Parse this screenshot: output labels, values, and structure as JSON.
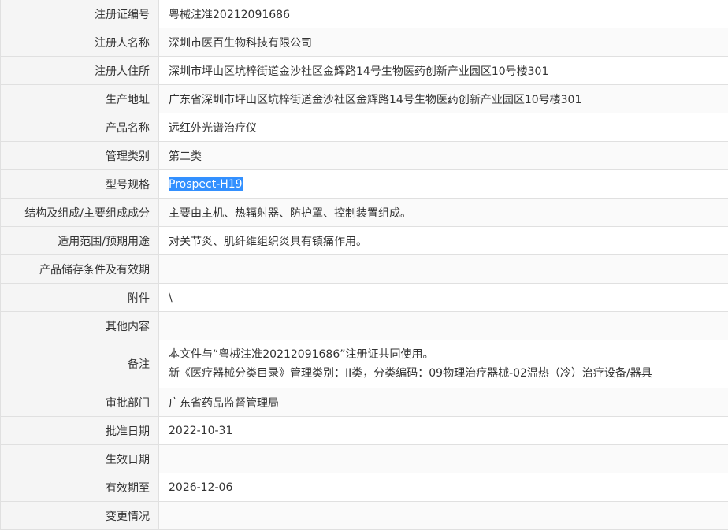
{
  "rows": [
    {
      "label": "注册证编号",
      "value": "粤械注准20212091686"
    },
    {
      "label": "注册人名称",
      "value": "深圳市医百生物科技有限公司"
    },
    {
      "label": "注册人住所",
      "value": "深圳市坪山区坑梓街道金沙社区金辉路14号生物医药创新产业园区10号楼301"
    },
    {
      "label": "生产地址",
      "value": "广东省深圳市坪山区坑梓街道金沙社区金辉路14号生物医药创新产业园区10号楼301"
    },
    {
      "label": "产品名称",
      "value": "远红外光谱治疗仪"
    },
    {
      "label": "管理类别",
      "value": "第二类"
    },
    {
      "label": "型号规格",
      "value": "Prospect-H19",
      "selected": true
    },
    {
      "label": "结构及组成/主要组成成分",
      "value": "主要由主机、热辐射器、防护罩、控制装置组成。"
    },
    {
      "label": "适用范围/预期用途",
      "value": "对关节炎、肌纤维组织炎具有镇痛作用。"
    },
    {
      "label": "产品储存条件及有效期",
      "value": ""
    },
    {
      "label": "附件",
      "value": "\\"
    },
    {
      "label": "其他内容",
      "value": ""
    },
    {
      "label": "备注",
      "lines": [
        "本文件与“粤械注准20212091686”注册证共同使用。",
        "新《医疗器械分类目录》管理类别：II类，分类编码：09物理治疗器械-02温热（冷）治疗设备/器具"
      ]
    },
    {
      "label": "审批部门",
      "value": "广东省药品监督管理局"
    },
    {
      "label": "批准日期",
      "value": "2022-10-31"
    },
    {
      "label": "生效日期",
      "value": ""
    },
    {
      "label": "有效期至",
      "value": "2026-12-06"
    },
    {
      "label": "变更情况",
      "value": ""
    }
  ]
}
